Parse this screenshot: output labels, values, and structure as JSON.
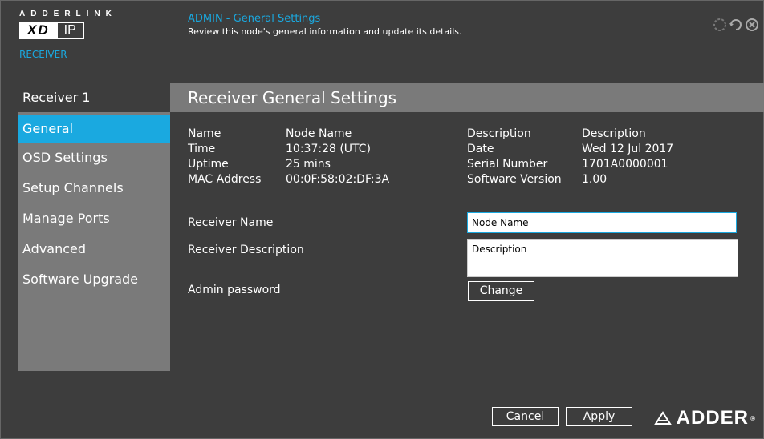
{
  "logo": {
    "wordmark": "ADDERLINK",
    "product_xd": "XD",
    "product_ip": "IP",
    "subtitle": "RECEIVER"
  },
  "header": {
    "title": "ADMIN - General Settings",
    "description": "Review this node's general information and update its details."
  },
  "top_icons": [
    "help-icon",
    "refresh-icon",
    "close-icon"
  ],
  "sidebar": {
    "heading": "Receiver 1",
    "items": [
      {
        "label": "General",
        "active": true
      },
      {
        "label": "OSD Settings"
      },
      {
        "label": "Setup Channels"
      },
      {
        "label": "Manage Ports"
      },
      {
        "label": "Advanced"
      },
      {
        "label": "Software Upgrade"
      }
    ]
  },
  "panel": {
    "title": "Receiver General Settings"
  },
  "info_left": {
    "labels": [
      "Name",
      "Time",
      "Uptime",
      "MAC Address"
    ],
    "values": [
      "Node Name",
      "10:37:28 (UTC)",
      "25 mins",
      "00:0F:58:02:DF:3A"
    ]
  },
  "info_right": {
    "labels": [
      "Description",
      "Date",
      "Serial Number",
      "Software Version"
    ],
    "values": [
      "Description",
      "Wed 12 Jul 2017",
      "1701A0000001",
      "1.00"
    ]
  },
  "form": {
    "receiver_name_label": "Receiver Name",
    "receiver_name_value": "Node Name",
    "receiver_description_label": "Receiver Description",
    "receiver_description_value": "Description",
    "admin_password_label": "Admin password",
    "change_button": "Change"
  },
  "footer": {
    "cancel_button": "Cancel",
    "apply_button": "Apply",
    "brand": "ADDER",
    "registered": "®"
  },
  "colors": {
    "background": "#3d3d3d",
    "accent": "#1aa9e0",
    "panel": "#7a7a7a"
  }
}
